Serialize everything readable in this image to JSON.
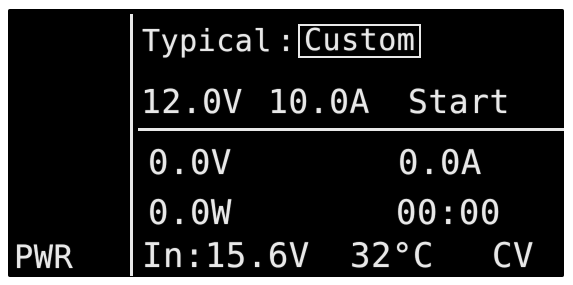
{
  "mode": {
    "label": "Typical",
    "separator": ":",
    "selected": "Custom"
  },
  "setpoint": {
    "voltage": "12.0V",
    "current": "10.0A",
    "action": "Start"
  },
  "output": {
    "voltage": "0.0V",
    "current": "0.0A",
    "power": "0.0W",
    "timer": "00:00"
  },
  "status": {
    "side_label": "PWR",
    "input": "In:15.6V",
    "temperature": "32°C",
    "regulation_mode": "CV"
  }
}
